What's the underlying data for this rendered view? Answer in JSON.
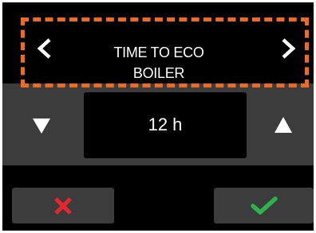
{
  "screen": {
    "title_line1": "TIME TO ECO",
    "title_line2": "BOILER"
  },
  "value": {
    "text": "12 h"
  },
  "icons": {
    "previous": "chevron-left-icon",
    "next": "chevron-right-icon",
    "decrease": "triangle-down-icon",
    "increase": "triangle-up-icon",
    "cancel": "close-icon",
    "confirm": "checkmark-icon"
  },
  "colors": {
    "background": "#000000",
    "panel": "#3c3c3c",
    "highlight": "#f26a21",
    "cancel": "#e8272c",
    "confirm": "#2db34a",
    "text": "#ffffff"
  }
}
